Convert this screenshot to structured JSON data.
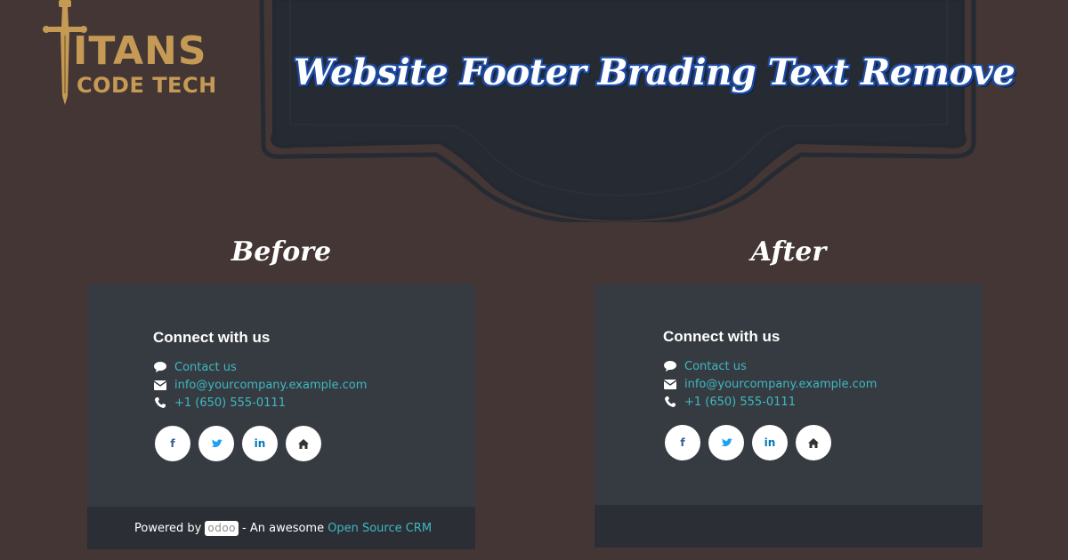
{
  "brand": {
    "logo_line1": "ITANS",
    "logo_line2": "CODE TECH",
    "logo_icon": "sword-icon",
    "gold_color": "#c59a55"
  },
  "headline": "Website Footer Brading Text Remove",
  "colors": {
    "background": "#433634",
    "shield": "#262b33",
    "panel": "#363b42",
    "copyright_bar": "#2b2f35",
    "link": "#3fb8c0",
    "headline_outline": "#1e4aa0"
  },
  "before": {
    "label": "Before",
    "connect_title": "Connect with us",
    "contacts": [
      {
        "icon": "comment-icon",
        "text": "Contact us"
      },
      {
        "icon": "envelope-icon",
        "text": "info@yourcompany.example.com"
      },
      {
        "icon": "phone-icon",
        "text": "+1 (650) 555-0111"
      }
    ],
    "social": [
      {
        "icon": "facebook-icon",
        "glyph": "f"
      },
      {
        "icon": "twitter-icon",
        "glyph": "🐦"
      },
      {
        "icon": "linkedin-icon",
        "glyph": "in"
      },
      {
        "icon": "home-icon",
        "glyph": "⌂"
      }
    ],
    "powered_prefix": "Powered by",
    "odoo_logo": "odoo",
    "powered_middle": "- An awesome",
    "powered_link": "Open Source CRM"
  },
  "after": {
    "label": "After",
    "connect_title": "Connect with us",
    "contacts": [
      {
        "icon": "comment-icon",
        "text": "Contact us"
      },
      {
        "icon": "envelope-icon",
        "text": "info@yourcompany.example.com"
      },
      {
        "icon": "phone-icon",
        "text": "+1 (650) 555-0111"
      }
    ],
    "social": [
      {
        "icon": "facebook-icon",
        "glyph": "f"
      },
      {
        "icon": "twitter-icon",
        "glyph": "🐦"
      },
      {
        "icon": "linkedin-icon",
        "glyph": "in"
      },
      {
        "icon": "home-icon",
        "glyph": "⌂"
      }
    ]
  }
}
